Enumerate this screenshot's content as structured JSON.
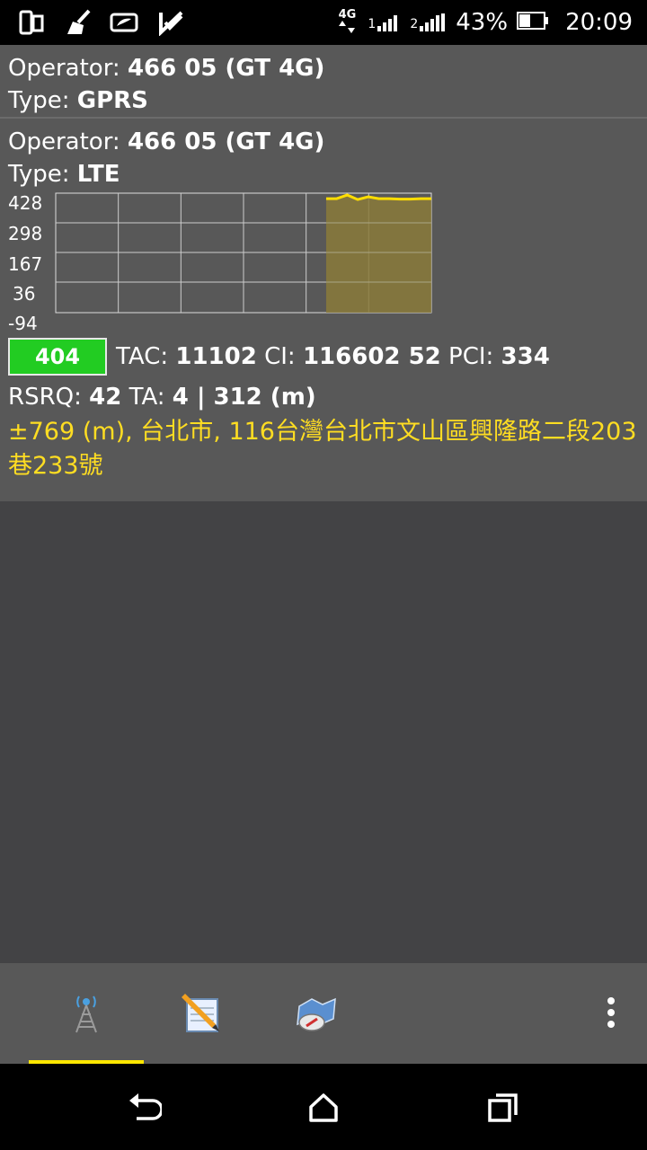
{
  "status_bar": {
    "network_type": "4G",
    "sim1_label": "1",
    "sim2_label": "2",
    "battery": "43%",
    "time": "20:09"
  },
  "cells": [
    {
      "operator_label": "Operator:",
      "operator_value": "466 05 (GT 4G)",
      "type_label": "Type:",
      "type_value": "GPRS"
    },
    {
      "operator_label": "Operator:",
      "operator_value": "466 05 (GT 4G)",
      "type_label": "Type:",
      "type_value": "LTE",
      "signal": "404",
      "tac_label": "TAC:",
      "tac_value": "11102",
      "ci_label": "CI:",
      "ci_value": "116602 52",
      "pci_label": "PCI:",
      "pci_value": "334",
      "rsrq_label": "RSRQ:",
      "rsrq_value": "42",
      "ta_label": "TA:",
      "ta_value": "4 | 312 (m)",
      "location": "±769 (m), 台北市, 116台灣台北市文山區興隆路二段203巷233號"
    }
  ],
  "chart_data": {
    "type": "area",
    "y_ticks": [
      "428",
      "298",
      "167",
      "36",
      "-94"
    ],
    "ylim": [
      -94,
      428
    ],
    "grid": true,
    "color_line": "#ffdd00",
    "color_fill": "#8a7a3a",
    "series": [
      {
        "values": [
          404,
          404,
          420,
          400,
          412,
          404,
          404,
          402,
          402,
          404,
          404
        ]
      }
    ],
    "x_start_fraction": 0.72
  },
  "toolbar": {
    "icons": [
      "cell-tower-icon",
      "notepad-icon",
      "map-compass-icon",
      "overflow-menu-icon"
    ]
  },
  "nav": {
    "icons": [
      "back-icon",
      "home-icon",
      "recents-icon"
    ]
  }
}
